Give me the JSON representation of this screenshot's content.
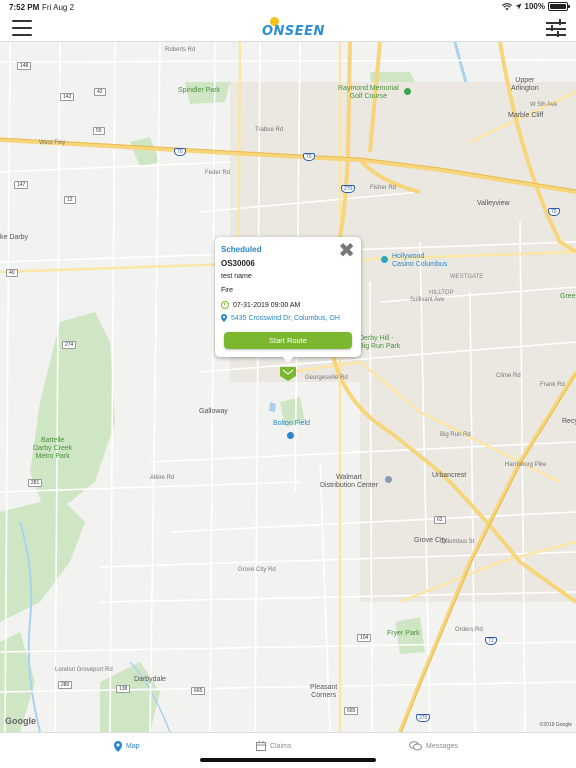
{
  "status_bar": {
    "time": "7:52 PM",
    "date": "Fri Aug 2",
    "battery": "100%",
    "battery_level": 1.0
  },
  "header": {
    "logo_text": "ONSEEN",
    "menu_icon": "hamburger-icon",
    "filter_icon": "sliders-icon"
  },
  "map": {
    "labels": {
      "spindler_park": "Spindler Park",
      "raymond_memorial": "Raymond Memorial\nGolf Course",
      "upper_arlington": "Upper\nArlington",
      "marble_cliff": "Marble Cliff",
      "west_fwy": "West Fwy",
      "valleyview": "Valleyview",
      "lake_darby": "ke Darby",
      "hollywood_casino": "Hollywood\nCasino Columbus",
      "westgate": "WESTGATE",
      "hilltop": "HILLTOP",
      "derby_hill": "Derby Hill -\nBig Run Park",
      "galloway": "Galloway",
      "bolton_field": "Bolton Field",
      "battelle_darby": "Battelle\nDarby Creek\nMetro Park",
      "walmart": "Walmart\nDistribution Center",
      "urbancrest": "Urbancrest",
      "grove_city": "Grove City",
      "fryer_park": "Fryer Park",
      "darbydale": "Darbydale",
      "pleasant_corners": "Pleasant\nCorners",
      "gree": "Green",
      "recy": "Recy",
      "roberts_rd": "Roberts Rd",
      "trabue_rd": "Trabue Rd",
      "fisher_rd": "Fisher Rd",
      "feder_rd": "Feder Rd",
      "georgesville_rd": "Georgesville Rd",
      "alkire_rd": "Alkire Rd",
      "big_run_rd": "Big Run Rd",
      "harrisburg_pike": "Harrisburg Pike",
      "frank_rd": "Frank Rd",
      "clime_rd": "Clime Rd",
      "grove_city_rd": "Grove City Rd",
      "columbus_st": "Columbus St",
      "orders_rd": "Orders Rd",
      "london_groveport": "London Groveport Rd",
      "sullivant_ave": "Sullivant Ave",
      "broad_st": "W Broad St",
      "w5th_ave": "W 5th Ave"
    },
    "shields": {
      "i70_a": "70",
      "i70_b": "70",
      "i70_c": "70",
      "i270_a": "270",
      "i270_b": "270",
      "i71": "71",
      "us40": "40",
      "us62": "62",
      "sr665": "665",
      "sr104": "104",
      "sr142": "142",
      "sr147": "147",
      "sr148": "148",
      "sr12": "12",
      "sr42": "42",
      "sr55": "55",
      "sr274": "274",
      "sr281": "281",
      "sr280": "280",
      "sr138": "138",
      "sr665b": "665"
    },
    "google": "Google",
    "copyright": "©2019 Google"
  },
  "callout": {
    "status": "Scheduled",
    "claim_id": "OS30006",
    "name": "test name",
    "loss_type": "Fire",
    "datetime": "07-31-2019 09:00 AM",
    "address": "5435 Crosswind Dr, Columbus, OH",
    "button": "Start Route"
  },
  "tabs": [
    {
      "label": "Map",
      "icon": "map-pin-icon",
      "active": true
    },
    {
      "label": "Claims",
      "icon": "calendar-icon",
      "active": false
    },
    {
      "label": "Messages",
      "icon": "chat-bubbles-icon",
      "active": false
    }
  ],
  "colors": {
    "accent_blue": "#2a86c8",
    "accent_green": "#7cb82f",
    "highway_yellow": "#f7d57a"
  }
}
